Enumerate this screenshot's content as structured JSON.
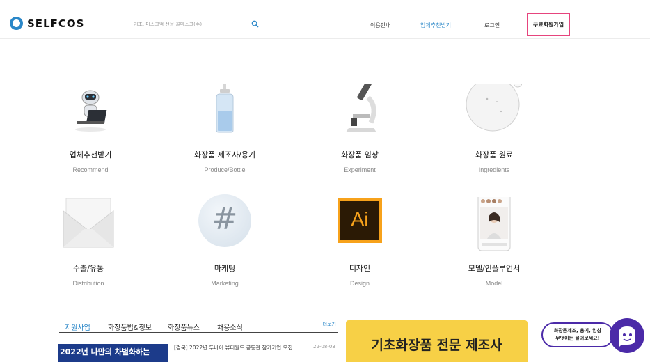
{
  "header": {
    "logo_text": "SELFCOS",
    "search_placeholder": "기초, 마스크팩 전문 콜마스크(주)",
    "nav": [
      "이용안내",
      "업체추천받기",
      "로그인"
    ],
    "signup_label": "무료회원가입"
  },
  "categories": [
    {
      "title": "업체추천받기",
      "sub": "Recommend"
    },
    {
      "title": "화장품 제조사/용기",
      "sub": "Produce/Bottle"
    },
    {
      "title": "화장품 임상",
      "sub": "Experiment"
    },
    {
      "title": "화장품 원료",
      "sub": "Ingredients"
    },
    {
      "title": "수출/유통",
      "sub": "Distribution"
    },
    {
      "title": "마케팅",
      "sub": "Marketing"
    },
    {
      "title": "디자인",
      "sub": "Design"
    },
    {
      "title": "모델/인플루언서",
      "sub": "Model"
    }
  ],
  "design_icon_text": "Ai",
  "marketing_icon_text": "#",
  "news": {
    "tabs": [
      "지원사업",
      "화장품법&정보",
      "화장품뉴스",
      "채용소식"
    ],
    "more_label": "더보기",
    "thumb_text": "2022년 나만의 차별화하는",
    "item_title": "[경북] 2022년 두바이 뷰티월드 공동관 참가기업 모집...",
    "item_date": "22-08-03"
  },
  "banner_text": "기초화장품 전문 제조사",
  "chat": {
    "line1": "화장품제조, 용기, 임상",
    "line2": "무엇이든 물어보세요!"
  },
  "colors": {
    "accent": "#2a87c8",
    "signup_border": "#e6447d",
    "banner": "#f7d046",
    "chat": "#4b2aa8"
  }
}
